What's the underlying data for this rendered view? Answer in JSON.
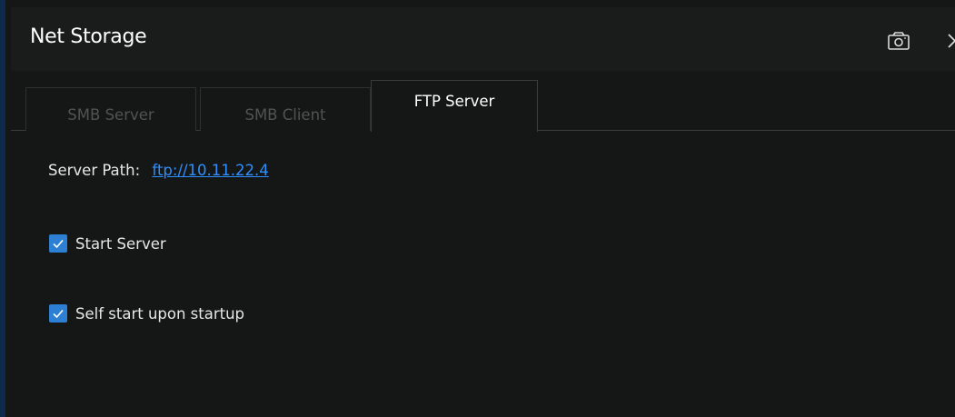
{
  "window": {
    "title": "Net Storage",
    "camera_icon": "camera-icon",
    "close_icon": "close-icon"
  },
  "tabs": [
    {
      "label": "SMB Server",
      "active": false
    },
    {
      "label": "SMB Client",
      "active": false
    },
    {
      "label": "FTP Server",
      "active": true
    }
  ],
  "ftp_server": {
    "server_path_label": "Server Path:",
    "server_path_value": "ftp://10.11.22.4",
    "options": [
      {
        "label": "Start Server",
        "checked": true
      },
      {
        "label": "Self start upon startup",
        "checked": true
      }
    ]
  },
  "colors": {
    "accent": "#2d7fd4",
    "link": "#2f8fff",
    "background": "#151716",
    "inactive_tab_text": "#4f5351"
  }
}
